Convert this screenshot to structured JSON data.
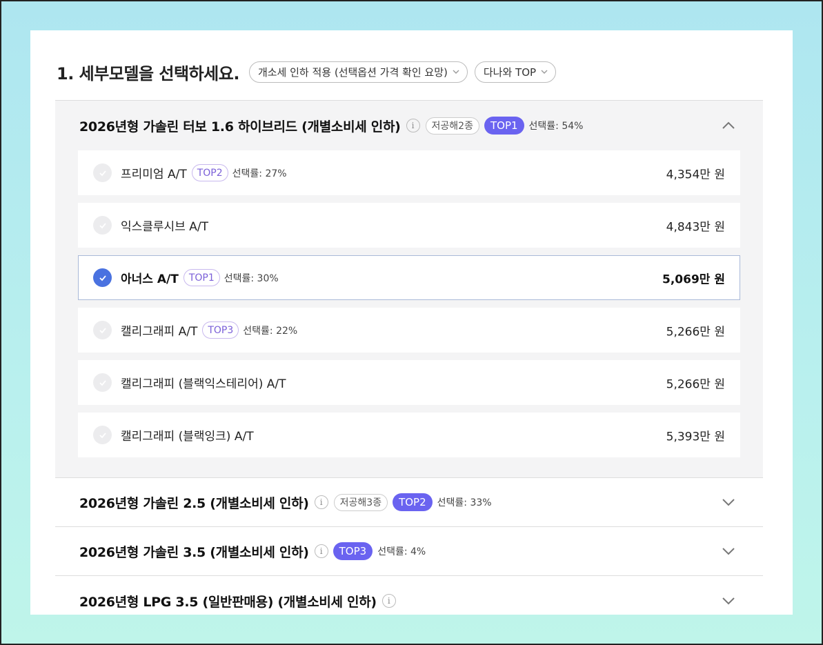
{
  "header": {
    "title": "1. 세부모델을 선택하세요.",
    "filter_tax": "개소세 인하 적용 (선택옵션 가격 확인 요망)",
    "filter_sort": "다나와 TOP"
  },
  "groups": [
    {
      "title": "2026년형 가솔린 터보 1.6 하이브리드 (개별소비세 인하)",
      "tag": "저공해2종",
      "top": "TOP1",
      "rate": "선택률: 54%",
      "expanded": true,
      "trims": [
        {
          "name": "프리미엄 A/T",
          "top": "TOP2",
          "rate": "선택률: 27%",
          "price": "4,354만 원",
          "selected": false
        },
        {
          "name": "익스클루시브 A/T",
          "top": "",
          "rate": "",
          "price": "4,843만 원",
          "selected": false
        },
        {
          "name": "아너스 A/T",
          "top": "TOP1",
          "rate": "선택률: 30%",
          "price": "5,069만 원",
          "selected": true
        },
        {
          "name": "캘리그래피 A/T",
          "top": "TOP3",
          "rate": "선택률: 22%",
          "price": "5,266만 원",
          "selected": false
        },
        {
          "name": "캘리그래피 (블랙익스테리어) A/T",
          "top": "",
          "rate": "",
          "price": "5,266만 원",
          "selected": false
        },
        {
          "name": "캘리그래피 (블랙잉크) A/T",
          "top": "",
          "rate": "",
          "price": "5,393만 원",
          "selected": false
        }
      ]
    },
    {
      "title": "2026년형 가솔린 2.5 (개별소비세 인하)",
      "tag": "저공해3종",
      "top": "TOP2",
      "rate": "선택률: 33%",
      "expanded": false
    },
    {
      "title": "2026년형 가솔린 3.5 (개별소비세 인하)",
      "tag": "",
      "top": "TOP3",
      "rate": "선택률: 4%",
      "expanded": false
    },
    {
      "title": "2026년형 LPG 3.5 (일반판매용) (개별소비세 인하)",
      "tag": "",
      "top": "",
      "rate": "",
      "expanded": false
    }
  ],
  "icons": {
    "info": "i"
  },
  "colors": {
    "accent_top_badge": "#6a63f0",
    "selected_check": "#4a72e0",
    "top_outline_text": "#7a5fd8"
  }
}
